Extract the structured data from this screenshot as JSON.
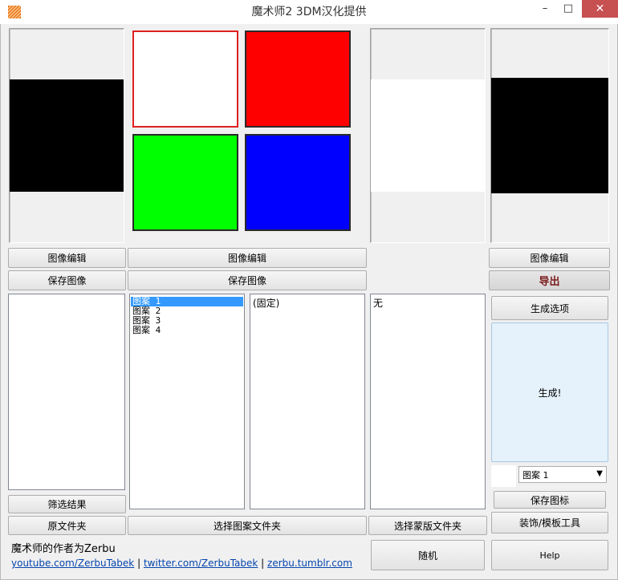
{
  "window": {
    "title": "魔术师2 3DM汉化提供",
    "min_glyph": "–",
    "max_glyph": "□",
    "close_glyph": "✕"
  },
  "buttons": {
    "edit_image_1": "图像编辑",
    "save_image_1": "保存图像",
    "edit_image_2": "图像编辑",
    "save_image_2": "保存图像",
    "edit_image_3": "图像编辑",
    "export": "导出",
    "gen_options": "生成选项",
    "generate": "生成!",
    "save_icon": "保存图标",
    "decor_tool": "装饰/模板工具",
    "filter_results": "筛选结果",
    "source_folder": "原文件夹",
    "select_pattern_folder": "选择图案文件夹",
    "select_mask_folder": "选择蒙版文件夹",
    "random": "随机",
    "help": "Help"
  },
  "pattern_list": {
    "items": [
      "图案 1",
      "图案 2",
      "图案 3",
      "图案 4"
    ],
    "selected_index": 0
  },
  "fixed_list": {
    "items": [
      "(固定)"
    ]
  },
  "mask_list": {
    "items": [
      "无"
    ]
  },
  "pattern_dropdown": {
    "value": "图案 1"
  },
  "credits": {
    "author": "魔术师的作者为Zerbu",
    "link1": "youtube.com/ZerbuTabek",
    "link2": "twitter.com/ZerbuTabek",
    "link3": "zerbu.tumblr.com",
    "sep": "|"
  },
  "colors": {
    "swatch1": "#ffffff",
    "swatch2": "#ff0000",
    "swatch3": "#00ff00",
    "swatch4": "#0000ff",
    "swatch1_border": "#e02020",
    "accent": "#3399ff"
  }
}
